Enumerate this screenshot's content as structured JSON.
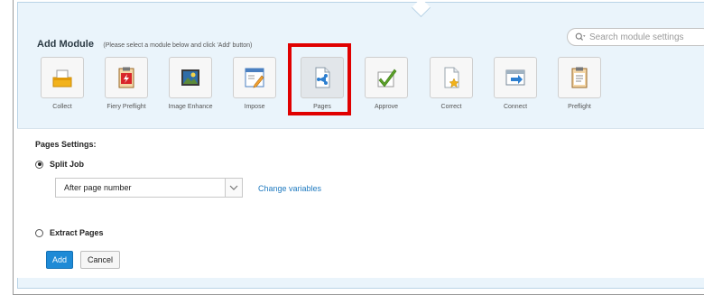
{
  "header": {
    "title": "Add Module",
    "hint": "(Please select a module below and click 'Add' button)"
  },
  "search": {
    "placeholder": "Search module settings",
    "icon": "search-icon"
  },
  "modules": [
    {
      "label": "Collect",
      "icon": "collect-icon"
    },
    {
      "label": "Fiery Preflight",
      "icon": "fiery-preflight-icon"
    },
    {
      "label": "Image Enhance",
      "icon": "image-enhance-icon"
    },
    {
      "label": "Impose",
      "icon": "impose-icon"
    },
    {
      "label": "Pages",
      "icon": "pages-icon",
      "selected": true
    },
    {
      "label": "Approve",
      "icon": "approve-icon"
    },
    {
      "label": "Correct",
      "icon": "correct-icon"
    },
    {
      "label": "Connect",
      "icon": "connect-icon"
    },
    {
      "label": "Preflight",
      "icon": "preflight-icon"
    }
  ],
  "settings": {
    "title": "Pages Settings:",
    "split_job": {
      "label": "Split Job",
      "selected": true
    },
    "split_select": {
      "value": "After page number"
    },
    "change_variables": "Change variables",
    "extract_pages": {
      "label": "Extract Pages",
      "selected": false
    }
  },
  "buttons": {
    "add": "Add",
    "cancel": "Cancel"
  },
  "colors": {
    "panel_bg": "#eaf4fb",
    "accent_blue": "#1e8ad6",
    "link_blue": "#1f7ac0",
    "highlight_red": "#e00000"
  }
}
